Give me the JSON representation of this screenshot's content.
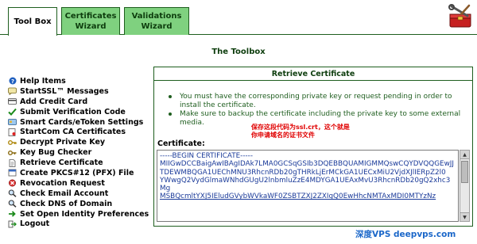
{
  "tabs": [
    {
      "label": "Tool Box"
    },
    {
      "label": "Certificates Wizard"
    },
    {
      "label": "Validations Wizard"
    }
  ],
  "page_title": "The Toolbox",
  "menu": [
    {
      "label": "Help Items",
      "icon": "question-icon"
    },
    {
      "label": "StartSSL™ Messages",
      "icon": "chat-icon"
    },
    {
      "label": "Add Credit Card",
      "icon": "card-icon"
    },
    {
      "label": "Submit Verification Code",
      "icon": "check-icon"
    },
    {
      "label": "Smart Cards/eToken Settings",
      "icon": "smartcard-icon"
    },
    {
      "label": "StartCom CA Certificates",
      "icon": "certificate-icon"
    },
    {
      "label": "Decrypt Private Key",
      "icon": "key-icon"
    },
    {
      "label": "Key Bug Checker",
      "icon": "key-bug-icon"
    },
    {
      "label": "Retrieve Certificate",
      "icon": "document-icon"
    },
    {
      "label": "Create PKCS#12 (PFX) File",
      "icon": "pfx-icon"
    },
    {
      "label": "Revocation Request",
      "icon": "revoke-icon"
    },
    {
      "label": "Check Email Account",
      "icon": "magnifier-icon"
    },
    {
      "label": "Check DNS of Domain",
      "icon": "magnifier-icon"
    },
    {
      "label": "Set Open Identity Preferences",
      "icon": "arrow-icon"
    },
    {
      "label": "Logout",
      "icon": "logout-icon"
    }
  ],
  "panel": {
    "title": "Retrieve Certificate",
    "bullets": [
      "You must have the corresponding private key or request pending in order to install the certificate.",
      "Make sure to backup the certificate including the private key to some external media."
    ],
    "note_line1": "保存这段代码为ssl.crt，这个就是",
    "note_line2": "你申请域名的证书文件",
    "cert_label": "Certificate:",
    "cert_lines": [
      "-----BEGIN CERTIFICATE-----",
      "MIIGwDCCBaigAwIBAgIDAk7LMA0GCSqGSIb3DQEBBQUAMIGMMQswCQYDVQQGEwJJ",
      "TDEWMBQGA1UEChMNU3RhcnRDb20gTHRkLjErMCkGA1UECxMiU2VjdXJlIERpZ2l0",
      "YWwgQ2VydGlmaWNhdGUgU2lnbmluZzE4MDYGA1UEAxMvU3RhcnRDb20gQ2xhc3Mg",
      "MSBQcmltYXJ5IEludGVybWVkaWF0ZSBTZXJ2ZXIgQ0EwHhcNMTAxMDI0MTYzNz"
    ]
  },
  "watermark": "深度VPS deepvps.com",
  "colors": {
    "tab_green": "#7fd17f",
    "border": "#1e5e1e",
    "bullet_text": "#1f5e1f",
    "note_red": "#e00000",
    "cert_text": "#1a3a99",
    "watermark": "#1b67c9"
  }
}
